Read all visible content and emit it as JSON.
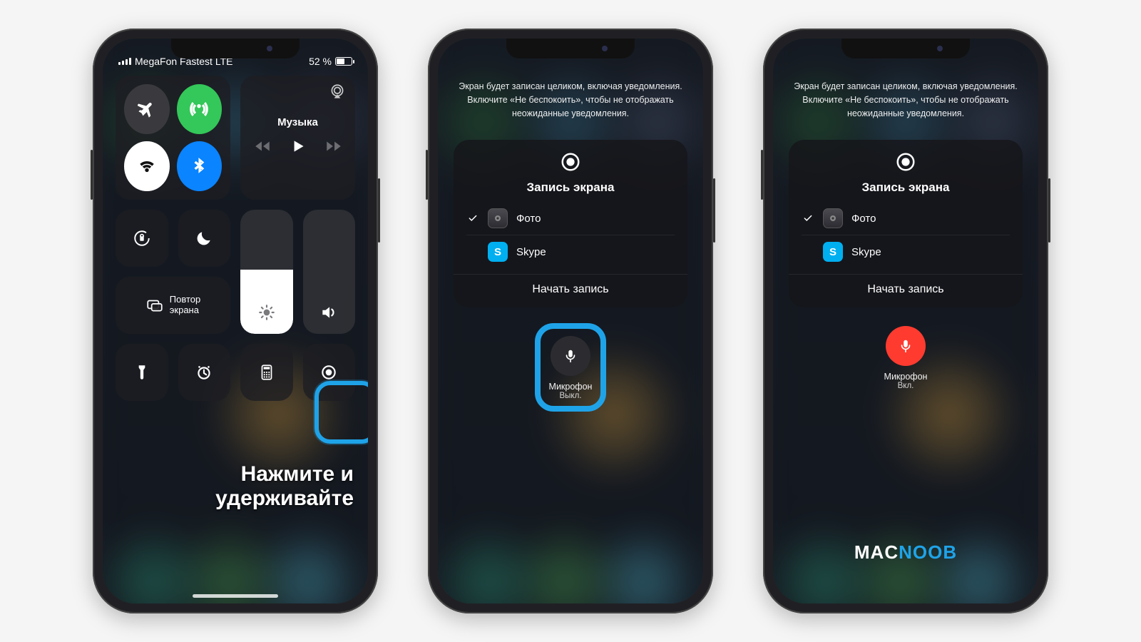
{
  "phone1": {
    "status": {
      "carrier": "MegaFon Fastest LTE",
      "battery_text": "52 %"
    },
    "music_label": "Музыка",
    "mirror_label": "Повтор\nэкрана",
    "caption": "Нажмите и удерживайте"
  },
  "record": {
    "notice": "Экран будет записан целиком, включая уведомления. Включите «Не беспокоить», чтобы не отображать неожиданные уведомления.",
    "title": "Запись экрана",
    "apps": [
      {
        "name": "Фото",
        "selected": true,
        "icon": "photo"
      },
      {
        "name": "Skype",
        "selected": false,
        "icon": "skype"
      }
    ],
    "start": "Начать запись",
    "mic_label": "Микрофон",
    "mic_off": "Выкл.",
    "mic_on": "Вкл."
  },
  "brand": {
    "a": "MAC",
    "b": "NOOB"
  }
}
